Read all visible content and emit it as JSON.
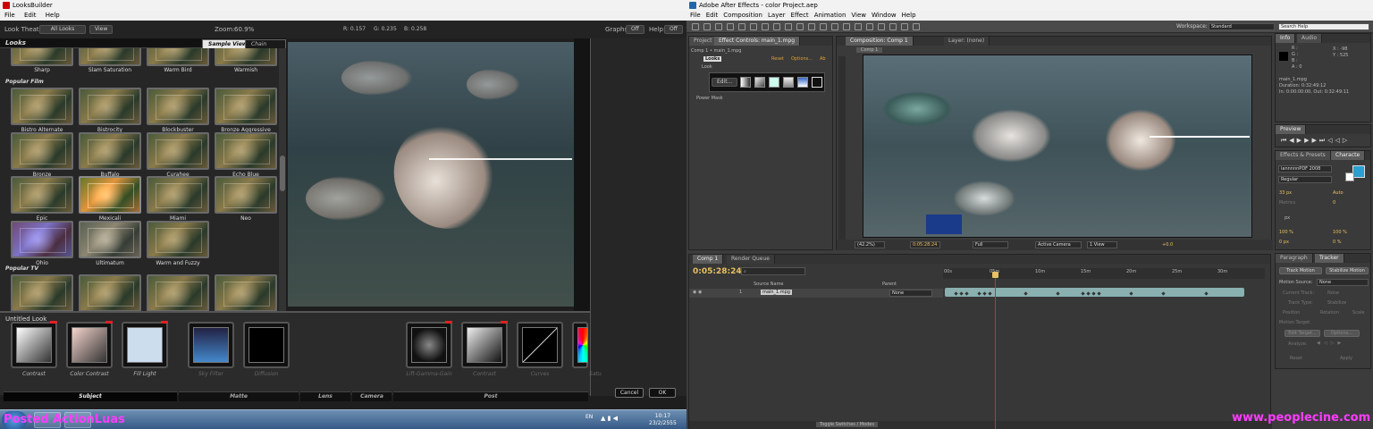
{
  "looksbuilder": {
    "window_title": "LooksBuilder",
    "menu": [
      "File",
      "Edit",
      "Help"
    ],
    "toolbar": {
      "look_theater_label": "Look Theater:",
      "look_theater_value": "All Looks",
      "view_button": "View",
      "zoom_label": "Zoom:",
      "zoom_value": "60.9%",
      "r_label": "R: 0.157",
      "g_label": "G: 0.235",
      "b_label": "B: 0.258",
      "graphs_label": "Graphs:",
      "graphs_value": "Off",
      "help_label": "Help:",
      "help_value": "Off"
    },
    "looks_header": "Looks",
    "tabs": [
      "Sample View",
      "Chain View"
    ],
    "top_row": [
      "Sharp",
      "Slam Saturation",
      "Warm Bird",
      "Warmish"
    ],
    "categories": [
      "Popular Film",
      "Popular TV"
    ],
    "film_looks": [
      "Bistro Alternate",
      "Bistrocity",
      "Blockbuster",
      "Bronze Aggressive",
      "Bronze",
      "Buffalo",
      "Curahee",
      "Echo Blue",
      "Epic",
      "Mexicali",
      "Miami",
      "Neo",
      "Ohio",
      "Ultimatum",
      "Warm and Fuzzy"
    ],
    "look_name": "Untitled Look",
    "tools": [
      {
        "label": "Contrast",
        "dim": false
      },
      {
        "label": "Color Contrast",
        "dim": false
      },
      {
        "label": "Fill Light",
        "dim": false
      },
      {
        "label": "Sky Filter",
        "dim": true
      },
      {
        "label": "Diffusion",
        "dim": true
      },
      {
        "label": "Lift-Gamma-Gain",
        "dim": true
      },
      {
        "label": "Contrast",
        "dim": true
      },
      {
        "label": "Curves",
        "dim": true
      },
      {
        "label": "Satu",
        "dim": true
      }
    ],
    "categories_bar": [
      "Subject",
      "Matte",
      "Lens",
      "Camera",
      "Post"
    ],
    "cancel_button": "Cancel",
    "ok_button": "OK",
    "tray_lang": "EN",
    "clock_time": "10:17",
    "clock_date": "23/2/2555",
    "watermark": "Posted ActionLuas"
  },
  "aftereffects": {
    "window_title": "Adobe After Effects - color Project.aep",
    "menu": [
      "File",
      "Edit",
      "Composition",
      "Layer",
      "Effect",
      "Animation",
      "View",
      "Window",
      "Help"
    ],
    "workspace_label": "Workspace:",
    "workspace_value": "Standard",
    "search_placeholder": "Search Help",
    "left_tabs": [
      "Project",
      "Effect Controls: main_1.mpg"
    ],
    "breadcrumb": "Comp 1 • main_1.mpg",
    "effect_name": "Looks",
    "effect_links": [
      "Reset",
      "Options...",
      "Ab"
    ],
    "look_group": "Look",
    "edit_button": "Edit...",
    "power_mask": "Power Mask",
    "comp_tabs": [
      "Composition: Comp 1",
      "Layer: (none)"
    ],
    "comp_subtab": "Comp 1",
    "comp_footer": {
      "zoom": "(42.2%)",
      "timecode": "0:05:28:24",
      "resolution": "Full",
      "camera": "Active Camera",
      "views": "1 View",
      "offset": "+0.0"
    },
    "info": {
      "tabs": [
        "Info",
        "Audio"
      ],
      "r": "R :",
      "g": "G :",
      "b": "B :",
      "a": "A : 0",
      "x": "X : -98",
      "y": "Y : 525",
      "clip_name": "main_1.mpg",
      "duration": "Duration: 0:32:49:12",
      "in_out": "In: 0:00:00:00, Out: 0:32:49:11"
    },
    "preview_tab": "Preview",
    "char_tabs": [
      "Effects & Presets",
      "Characte"
    ],
    "font_name": "iannnnnPDF 2008",
    "font_style": "Regular",
    "font_size": "33 px",
    "leading": "Auto",
    "tracking_metrics": "Metrics",
    "kerning": "0",
    "stroke": "px",
    "v_scale": "100 %",
    "h_scale": "100 %",
    "baseline": "0 px",
    "tsume": "0 %",
    "tracker_tabs": [
      "Paragraph",
      "Tracker"
    ],
    "tracker": {
      "track_motion": "Track Motion",
      "stabilize_motion": "Stabilize Motion",
      "motion_source_label": "Motion Source:",
      "motion_source_value": "None",
      "current_track": "Current Track:",
      "current_track_value": "None",
      "track_type": "Track Type:",
      "track_type_value": "Stabilize",
      "position": "Position",
      "rotation": "Rotation",
      "scale": "Scale",
      "motion_target": "Motion Target:",
      "edit_target": "Edit Target...",
      "options": "Options...",
      "analyze": "Analyze:",
      "reset": "Reset",
      "apply": "Apply"
    },
    "timeline_tabs": [
      "Comp 1",
      "Render Queue"
    ],
    "timecode": "0:05:28:24",
    "columns": [
      "Source Name",
      "Parent"
    ],
    "layer": {
      "index": "1",
      "name": "main_1.mpg",
      "parent": "None"
    },
    "ruler_ticks": [
      "00s",
      "05m",
      "10m",
      "15m",
      "20m",
      "25m",
      "30m"
    ],
    "footer_toggle": "Toggle Switches / Modes",
    "watermark": "www.peoplecine.com"
  }
}
